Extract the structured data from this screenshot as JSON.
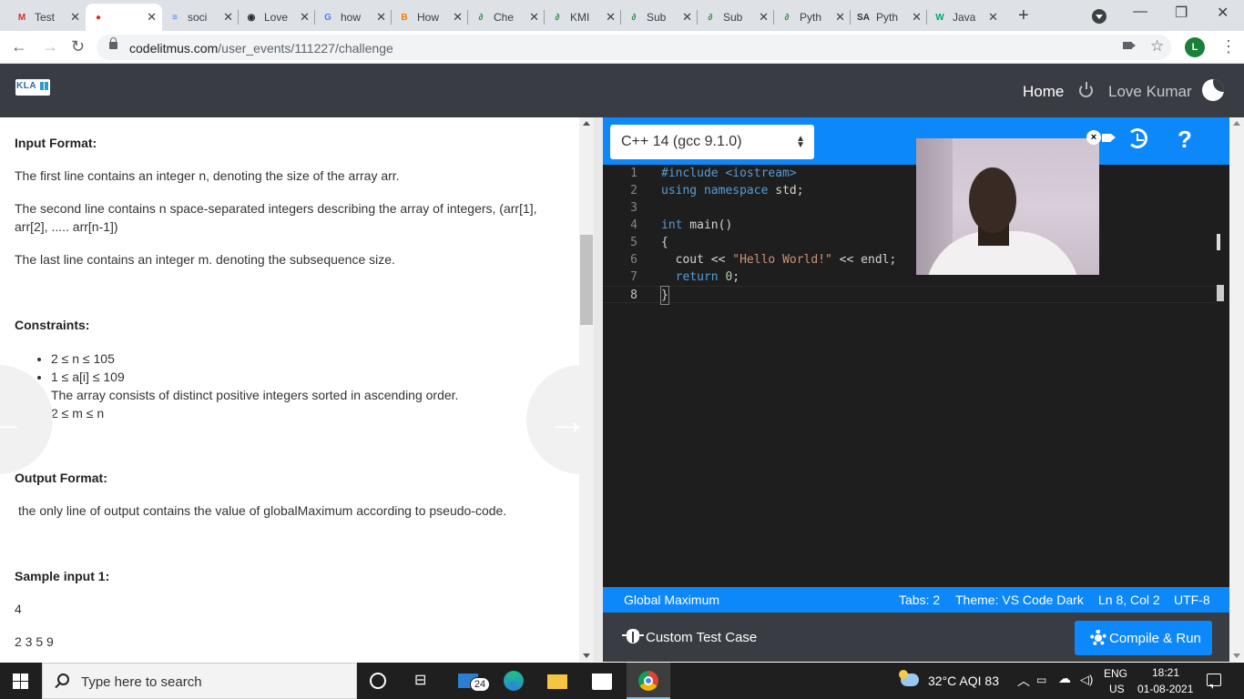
{
  "browser": {
    "tabs": [
      {
        "title": "Test",
        "favicon": "gmail-icon",
        "glyph": "M",
        "color": "#d93025"
      },
      {
        "title": "",
        "favicon": "github-icon",
        "glyph": "●",
        "color": "#d93025",
        "active": true
      },
      {
        "title": "soci",
        "favicon": "docs-icon",
        "glyph": "≡",
        "color": "#4285f4"
      },
      {
        "title": "Love",
        "favicon": "github-icon",
        "glyph": "◉",
        "color": "#24292e"
      },
      {
        "title": "how",
        "favicon": "google-icon",
        "glyph": "G",
        "color": "#4285f4"
      },
      {
        "title": "How",
        "favicon": "blogger-icon",
        "glyph": "B",
        "color": "#f57d00"
      },
      {
        "title": "Che",
        "favicon": "geeksforgeeks-icon",
        "glyph": "∂",
        "color": "#2f8d46"
      },
      {
        "title": "KMI",
        "favicon": "geeksforgeeks-icon",
        "glyph": "∂",
        "color": "#2f8d46"
      },
      {
        "title": "Sub",
        "favicon": "geeksforgeeks-icon",
        "glyph": "∂",
        "color": "#2f8d46"
      },
      {
        "title": "Sub",
        "favicon": "geeksforgeeks-icon",
        "glyph": "∂",
        "color": "#2f8d46"
      },
      {
        "title": "Pyth",
        "favicon": "geeksforgeeks-icon",
        "glyph": "∂",
        "color": "#2f8d46"
      },
      {
        "title": "Pyth",
        "favicon": "sa-icon",
        "glyph": "SA",
        "color": "#333333"
      },
      {
        "title": "Java",
        "favicon": "w3-icon",
        "glyph": "W",
        "color": "#04aa6d"
      }
    ],
    "url_host": "codelitmus.com",
    "url_path": "/user_events/111227/challenge",
    "profile_initial": "L"
  },
  "header": {
    "logo_text": "KLA",
    "home": "Home",
    "user_name": "Love Kumar"
  },
  "problem": {
    "input_format_title": "Input Format:",
    "input_line1": "The first line contains an integer n, denoting the size of the array arr.",
    "input_line2": "The second line contains n space-separated integers describing the array of integers, (arr[1], arr[2], ..... arr[n-1])",
    "input_line3": "The last line contains an integer m. denoting the subsequence size.",
    "constraints_title": "Constraints:",
    "constraints": [
      "2 ≤ n ≤ 105",
      "1 ≤ a[i] ≤ 109",
      "The array consists of distinct positive integers sorted in ascending order.",
      "2 ≤ m ≤ n"
    ],
    "output_format_title": "Output Format:",
    "output_line": "the only line of output contains the value of globalMaximum according to pseudo-code.",
    "sample_title": "Sample input 1:",
    "sample_line1": "4",
    "sample_line2": "2 3 5 9"
  },
  "editor": {
    "language": "C++ 14 (gcc 9.1.0)",
    "code_lines": [
      "#include <iostream>",
      "using namespace std;",
      "",
      "int main()",
      "{",
      "  cout << \"Hello World!\" << endl;",
      "  return 0;",
      "}"
    ],
    "line_numbers": [
      "1",
      "2",
      "3",
      "4",
      "5",
      "6",
      "7",
      "8"
    ],
    "status": {
      "problem_name": "Global Maximum",
      "tabs": "Tabs: 2",
      "theme": "Theme: VS Code Dark",
      "cursor": "Ln 8, Col 2",
      "encoding": "UTF-8"
    },
    "custom_test_label": "Custom Test Case",
    "compile_label": "Compile & Run",
    "cam_close": "×",
    "help": "?"
  },
  "taskbar": {
    "search_placeholder": "Type here to search",
    "mail_badge": "24",
    "weather": "32°C  AQI 83",
    "lang_top": "ENG",
    "lang_bottom": "US",
    "time": "18:21",
    "date": "01-08-2021"
  },
  "colors": {
    "accent_blue": "#0c88fb",
    "header_dark": "#393c42",
    "editor_bg": "#1e1e1e"
  }
}
